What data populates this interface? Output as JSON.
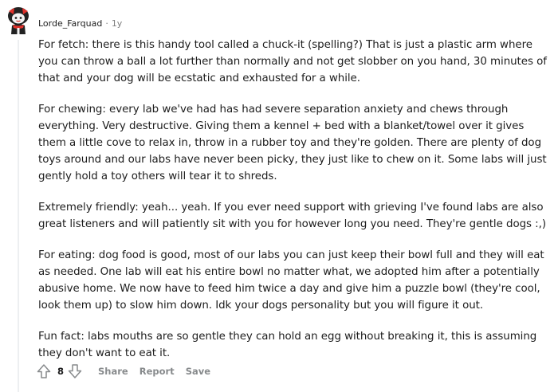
{
  "comment": {
    "username": "Lorde_Farquad",
    "separator": "·",
    "timestamp": "1y",
    "paragraphs": [
      "For fetch: there is this handy tool called a chuck-it (spelling?) That is just a plastic arm where you can throw a ball a lot further than normally and not get slobber on you hand, 30 minutes of that and your dog will be ecstatic and exhausted for a while.",
      "For chewing: every lab we've had has had severe separation anxiety and chews through everything. Very destructive. Giving them a kennel + bed with a blanket/towel over it gives them a little cove to relax in, throw in a rubber toy and they're golden. There are plenty of dog toys around and our labs have never been picky, they just like to chew on it. Some labs will just gently hold a toy others will tear it to shreds.",
      "Extremely friendly: yeah... yeah. If you ever need support with grieving I've found labs are also great listeners and will patiently sit with you for however long you need. They're gentle dogs :,)",
      "For eating: dog food is good, most of our labs you can just keep their bowl full and they will eat as needed. One lab will eat his entire bowl no matter what, we adopted him after a potentially abusive home. We now have to feed him twice a day and give him a puzzle bowl (they're cool, look them up) to slow him down. Idk your dogs personality but you will figure it out.",
      "Fun fact: labs mouths are so gentle they can hold an egg without breaking it, this is assuming they don't want to eat it."
    ],
    "score": "8",
    "actions": {
      "share": "Share",
      "report": "Report",
      "save": "Save"
    }
  },
  "icons": {
    "avatar": "avatar-icon",
    "upvote": "upvote-arrow-icon",
    "downvote": "downvote-arrow-icon"
  },
  "colors": {
    "text": "#1c1c1c",
    "meta": "#7c7c7c",
    "action": "#878a8c",
    "thread_line": "#edeff1",
    "avatar_red": "#e0312b",
    "avatar_dark": "#222222"
  }
}
